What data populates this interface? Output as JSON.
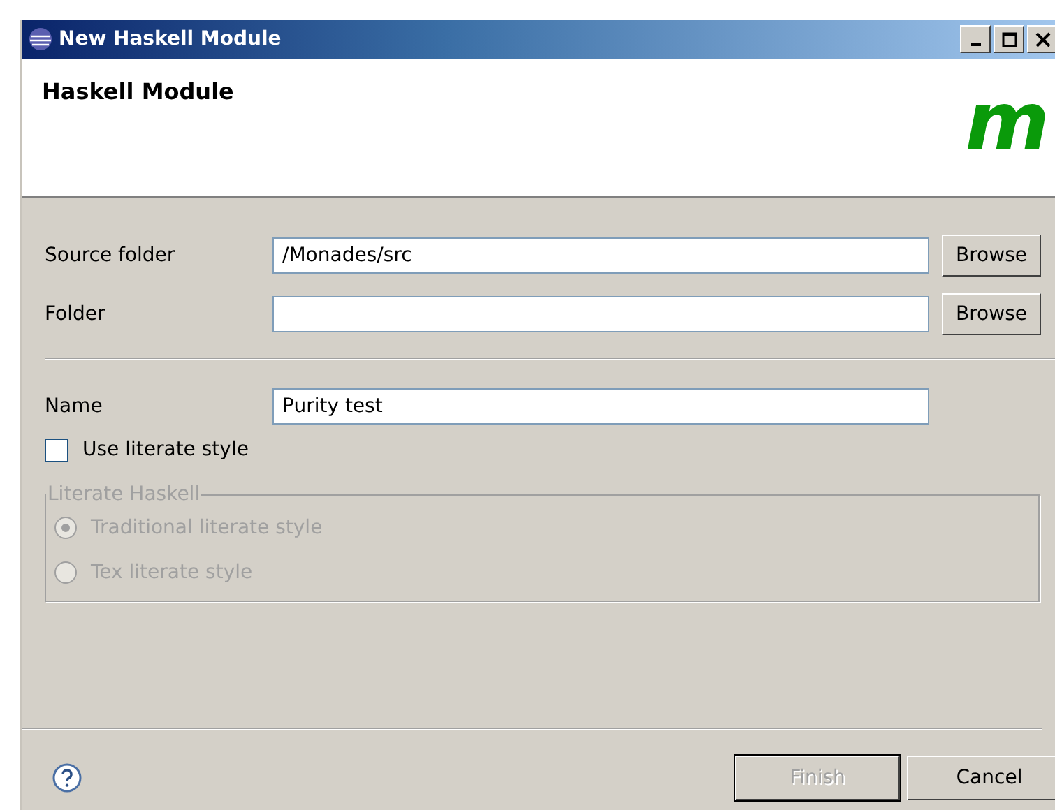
{
  "window": {
    "title": "New Haskell Module"
  },
  "header": {
    "title": "Haskell Module",
    "logo": "m"
  },
  "folder_fields": [
    {
      "label": "Source folder",
      "value": "/Monades/src",
      "button": "Browse"
    },
    {
      "label": "Folder",
      "button": "Browse"
    }
  ],
  "name_field": {
    "label": "Name",
    "value": "Purity test"
  },
  "literate_checkbox": {
    "label": "Use literate style",
    "checked": false
  },
  "literate_group": {
    "legend": "Literate Haskell",
    "disabled": true,
    "options": [
      {
        "label": "Traditional literate style",
        "selected": true
      },
      {
        "label": "Tex literate style",
        "selected": false
      }
    ]
  },
  "buttons": [
    {
      "label": "Finish",
      "disabled": true
    },
    {
      "label": "Cancel",
      "disabled": false
    }
  ]
}
